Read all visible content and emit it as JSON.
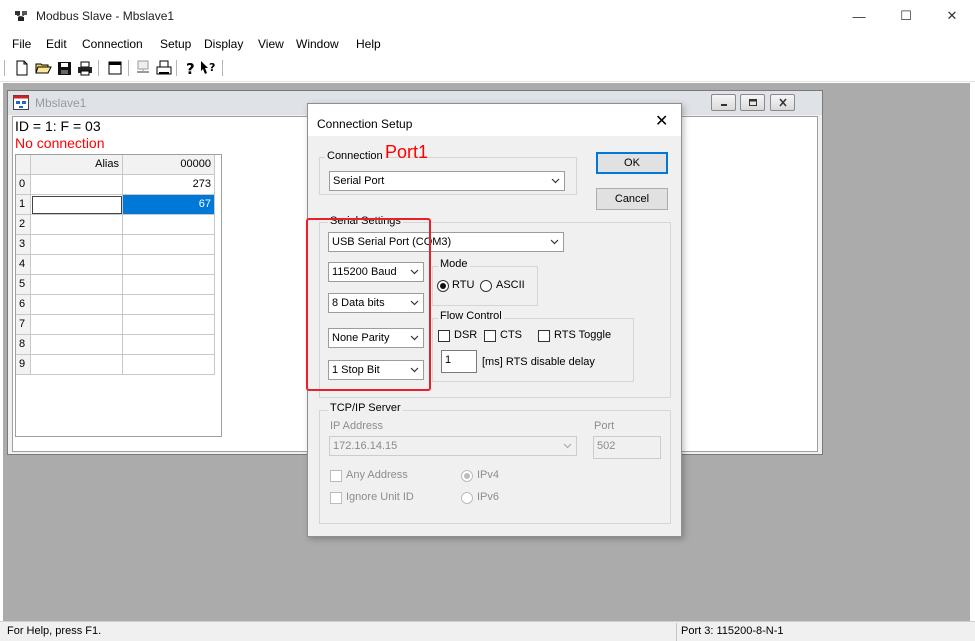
{
  "window": {
    "title": "Modbus Slave - Mbslave1",
    "controls": {
      "minimize": "—",
      "maximize": "☐",
      "close": "✕"
    }
  },
  "menu": [
    "File",
    "Edit",
    "Connection",
    "Setup",
    "Display",
    "View",
    "Window",
    "Help"
  ],
  "toolbar": {
    "icons": [
      "new-document-icon",
      "open-folder-icon",
      "save-disk-icon",
      "print-icon",
      "window-icon",
      "connect-icon",
      "printer-setup-icon",
      "help-icon",
      "context-help-icon"
    ]
  },
  "child": {
    "title": "Mbslave1",
    "status": "ID = 1: F = 03",
    "connection": "No connection",
    "grid": {
      "headers": [
        "",
        "Alias",
        "00000"
      ],
      "rows": [
        {
          "index": "0",
          "alias": "",
          "value": "273"
        },
        {
          "index": "1",
          "alias": "",
          "value": "67"
        },
        {
          "index": "2",
          "alias": "",
          "value": ""
        },
        {
          "index": "3",
          "alias": "",
          "value": ""
        },
        {
          "index": "4",
          "alias": "",
          "value": ""
        },
        {
          "index": "5",
          "alias": "",
          "value": ""
        },
        {
          "index": "6",
          "alias": "",
          "value": ""
        },
        {
          "index": "7",
          "alias": "",
          "value": ""
        },
        {
          "index": "8",
          "alias": "",
          "value": ""
        },
        {
          "index": "9",
          "alias": "",
          "value": ""
        }
      ],
      "selected_color": "#0078d7"
    }
  },
  "dialog": {
    "title": "Connection Setup",
    "close": "✕",
    "connection": {
      "label": "Connection",
      "value": "Serial Port"
    },
    "ok": "OK",
    "cancel": "Cancel",
    "serial": {
      "label": "Serial Settings",
      "port": "USB Serial Port (COM3)",
      "baud": "115200 Baud",
      "data_bits": "8 Data bits",
      "parity": "None Parity",
      "stop_bits": "1 Stop Bit",
      "mode": {
        "label": "Mode",
        "rtu": "RTU",
        "ascii": "ASCII",
        "selected": "RTU"
      },
      "flow": {
        "label": "Flow Control",
        "dsr": "DSR",
        "cts": "CTS",
        "rts_toggle": "RTS Toggle",
        "delay_value": "1",
        "delay_label": "[ms] RTS disable delay"
      }
    },
    "tcp": {
      "label": "TCP/IP Server",
      "ip_label": "IP Address",
      "ip_value": "172.16.14.15",
      "port_label": "Port",
      "port_value": "502",
      "any_address": "Any Address",
      "ignore_unit": "Ignore Unit ID",
      "ipv4": "IPv4",
      "ipv6": "IPv6",
      "ip_version_selected": "IPv4"
    }
  },
  "annotations": {
    "port_label": "Port1",
    "color": "#e8202a"
  },
  "statusbar": {
    "help": "For Help, press F1.",
    "port": "Port 3: 115200-8-N-1"
  }
}
